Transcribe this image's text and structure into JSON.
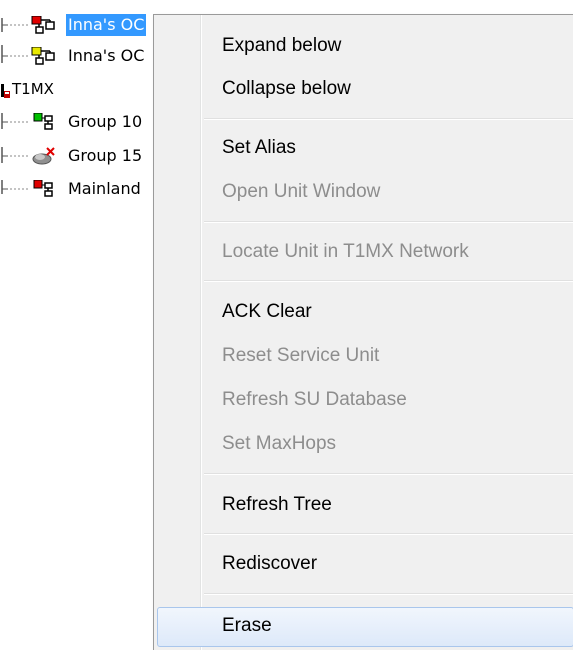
{
  "tree": {
    "items": [
      {
        "label": "Inna's OC",
        "color": "#e00000",
        "selected": true
      },
      {
        "label": "Inna's OC",
        "color": "#e8e800",
        "selected": false
      },
      {
        "label": "T1MX",
        "color": "#c00000",
        "selected": false
      },
      {
        "label": "Group 10",
        "color": "#00c000",
        "selected": false
      },
      {
        "label": "Group 15",
        "color": "#808080",
        "selected": false
      },
      {
        "label": "Mainland",
        "color": "#e00000",
        "selected": false
      }
    ]
  },
  "menu": {
    "items": [
      {
        "label": "Expand below",
        "enabled": true
      },
      {
        "label": "Collapse below",
        "enabled": true
      },
      {
        "label": "Set Alias",
        "enabled": true
      },
      {
        "label": "Open Unit Window",
        "enabled": false
      },
      {
        "label": "Locate Unit in T1MX Network",
        "enabled": false
      },
      {
        "label": "ACK Clear",
        "enabled": true
      },
      {
        "label": "Reset Service Unit",
        "enabled": false
      },
      {
        "label": "Refresh SU Database",
        "enabled": false
      },
      {
        "label": "Set MaxHops",
        "enabled": false
      },
      {
        "label": "Refresh Tree",
        "enabled": true
      },
      {
        "label": "Rediscover",
        "enabled": true
      },
      {
        "label": "Erase",
        "enabled": true,
        "hovered": true
      }
    ]
  },
  "colors": {
    "selection": "#3399ff",
    "menu_background": "#f0f0f0",
    "disabled_text": "#8d8d8d"
  }
}
